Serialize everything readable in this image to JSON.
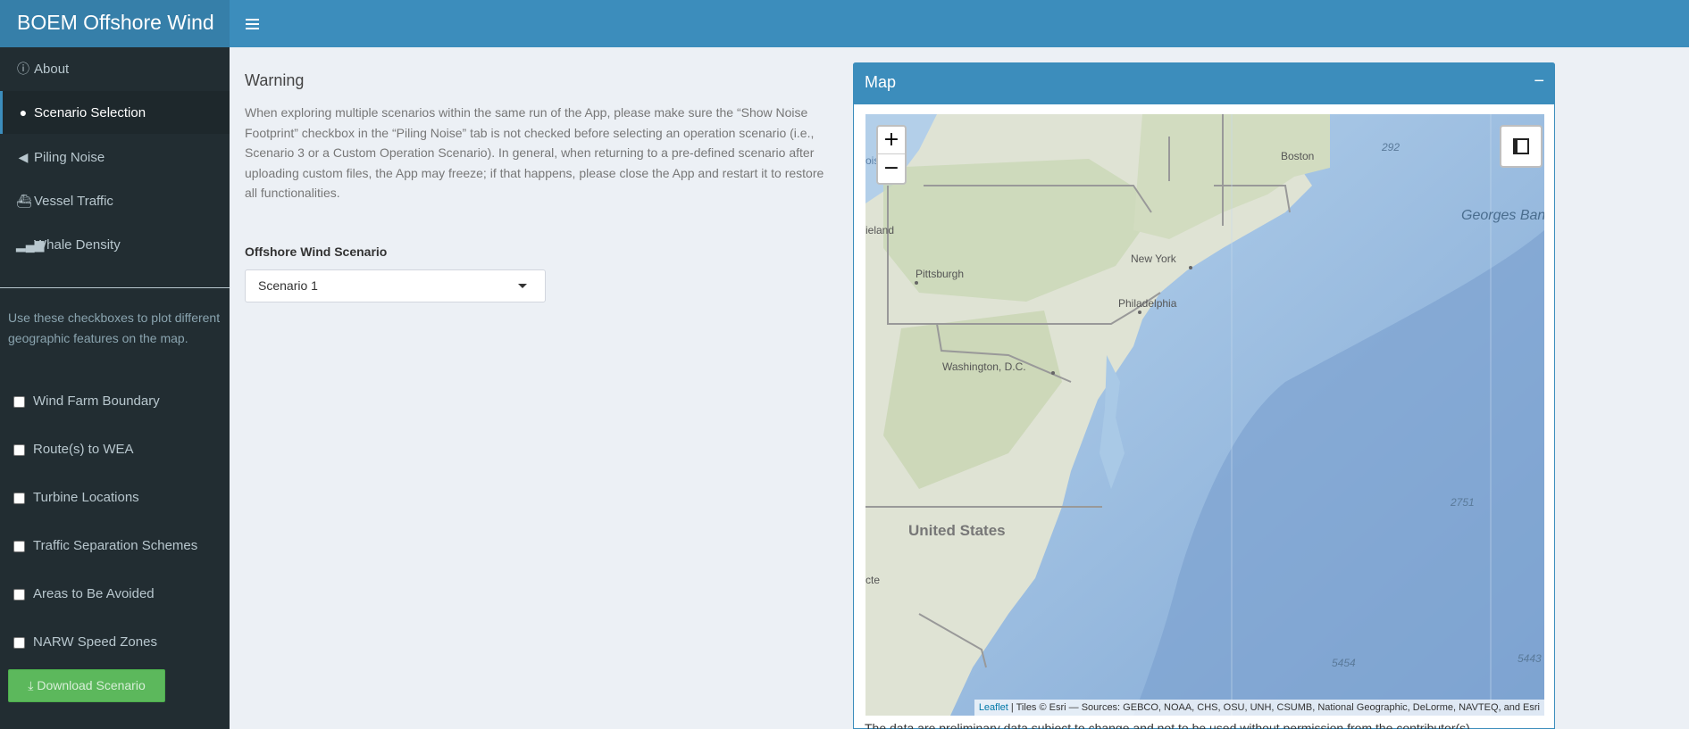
{
  "app": {
    "title": "BOEM Offshore Wind"
  },
  "sidebar": {
    "items": [
      {
        "label": "About",
        "icon": "info-circle-icon"
      },
      {
        "label": "Scenario Selection",
        "icon": "map-marker-icon",
        "active": true
      },
      {
        "label": "Piling Noise",
        "icon": "volume-icon"
      },
      {
        "label": "Vessel Traffic",
        "icon": "ship-icon"
      },
      {
        "label": "Whale Density",
        "icon": "signal-icon"
      }
    ],
    "help_text": "Use these checkboxes to plot different geographic features on the map.",
    "checkboxes": [
      {
        "label": "Wind Farm Boundary",
        "checked": false
      },
      {
        "label": "Route(s) to WEA",
        "checked": false
      },
      {
        "label": "Turbine Locations",
        "checked": false
      },
      {
        "label": "Traffic Separation Schemes",
        "checked": false
      },
      {
        "label": "Areas to Be Avoided",
        "checked": false
      },
      {
        "label": "NARW Speed Zones",
        "checked": false
      }
    ],
    "download_label": "Download Scenario"
  },
  "warning": {
    "title": "Warning",
    "text": "When exploring multiple scenarios within the same run of the App, please make sure the “Show Noise Footprint” checkbox in the “Piling Noise” tab is not checked before selecting an operation scenario (i.e., Scenario 3 or a Custom Operation Scenario). In general, when returning to a pre-defined scenario after uploading custom files, the App may freeze; if that happens, please close the App and restart it to restore all functionalities."
  },
  "scenario": {
    "label": "Offshore Wind Scenario",
    "selected": "Scenario 1"
  },
  "map_box": {
    "title": "Map",
    "collapse": "−",
    "zoom_in": "+",
    "zoom_out": "−",
    "labels": {
      "boston": "Boston",
      "new_york": "New York",
      "pittsburgh": "Pittsburgh",
      "philadelphia": "Philadelphia",
      "washington": "Washington, D.C.",
      "united_states": "United States",
      "georges_bank": "Georges Bank",
      "ieland": "ieland",
      "cte": "cte",
      "oise": "oise",
      "d292": "292",
      "d2751": "2751",
      "d5454": "5454",
      "d5443": "5443"
    },
    "attribution_link": "Leaflet",
    "attribution_text": " | Tiles © Esri — Sources: GEBCO, NOAA, CHS, OSU, UNH, CSUMB, National Geographic, DeLorme, NAVTEQ, and Esri"
  },
  "footer_text": "The data are preliminary data subject to change and not to be used without permission from the contributor(s)."
}
